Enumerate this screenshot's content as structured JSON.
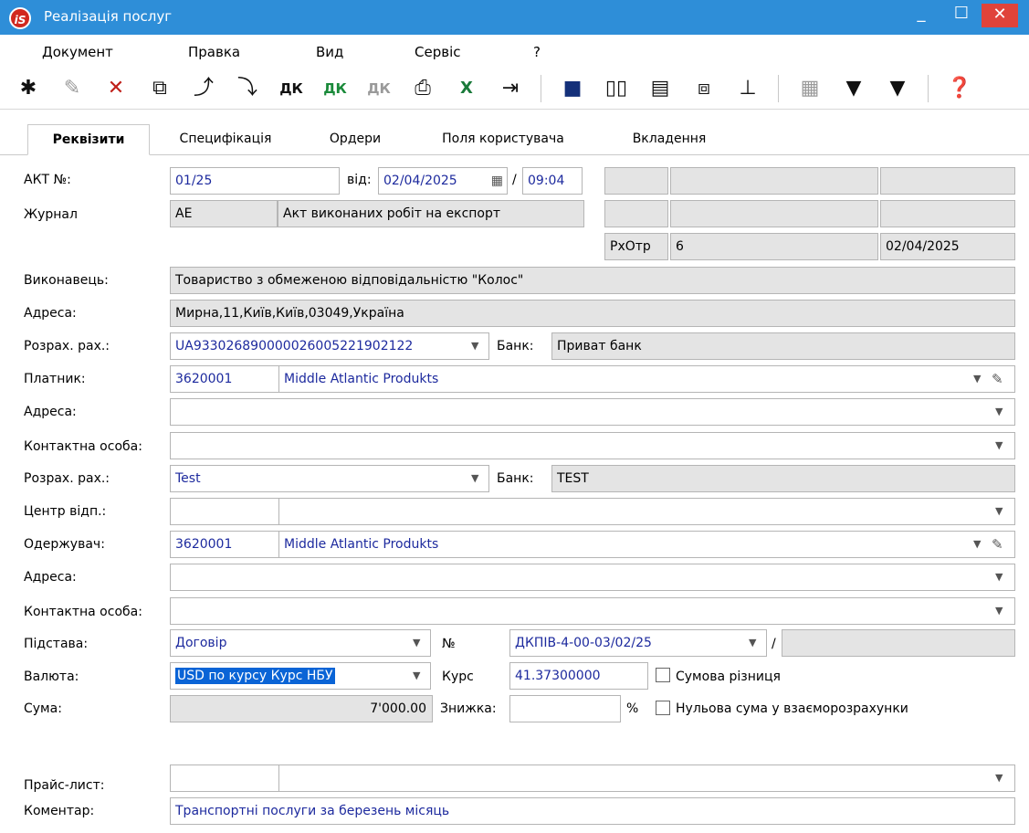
{
  "window": {
    "title": "Реалізація послуг",
    "logo": "iS"
  },
  "menu": [
    "Документ",
    "Правка",
    "Вид",
    "Сервіс",
    "?"
  ],
  "toolbar_icons": [
    "new-doc-icon",
    "edit-doc-icon",
    "delete-doc-icon",
    "copy-doc-icon",
    "import-doc-icon",
    "export-doc-icon",
    "dk-icon",
    "dk-green-icon",
    "dk-disabled-icon",
    "print-icon",
    "excel-icon",
    "exit-icon",
    "save-icon",
    "book-icon",
    "folder-icon",
    "link-icon",
    "tree-icon",
    "grid-icon",
    "filter-icon",
    "clear-filter-icon",
    "help-icon"
  ],
  "tabs": [
    "Реквізити",
    "Специфікація",
    "Ордери",
    "Поля користувача",
    "Вкладення"
  ],
  "form": {
    "akt_label": "АКТ №:",
    "akt_number": "01/25",
    "from_label": "від:",
    "date": "02/04/2025",
    "slash": "/",
    "time": "09:04",
    "journal_label": "Журнал",
    "journal_code": "АЕ",
    "journal_name": "Акт виконаних робіт на експорт",
    "rxotr_label": "РхОтр",
    "rxotr_value": "6",
    "rxotr_date": "02/04/2025",
    "executor_label": "Виконавець:",
    "executor_value": "Товариство з обмеженою відповідальністю \"Колос\"",
    "address_label": "Адреса:",
    "executor_address": "Мирна,11,Київ,Київ,03049,Україна",
    "account_label": "Розрах. рах.:",
    "executor_account": "UA933026890000026005221902122",
    "bank_label": "Банк:",
    "executor_bank": "Приват банк",
    "payer_label": "Платник:",
    "payer_code": "3620001",
    "payer_name": "Middle Atlantic Produkts",
    "payer_address": "",
    "contact_label": "Контактна особа:",
    "payer_contact": "",
    "payer_account": "Test",
    "payer_bank": "TEST",
    "center_label": "Центр відп.:",
    "center_code": "",
    "center_name": "",
    "receiver_label": "Одержувач:",
    "receiver_code": "3620001",
    "receiver_name": "Middle Atlantic Produkts",
    "receiver_address": "",
    "receiver_contact": "",
    "basis_label": "Підстава:",
    "basis_value": "Договір",
    "num_label": "№",
    "contract_number": "ДКПІВ-4-00-03/02/25",
    "currency_label": "Валюта:",
    "currency_value": "USD по курсу Курс НБУ",
    "rate_label": "Курс",
    "rate_value": "41.37300000",
    "sum_diff_label": "Сумова різниця",
    "sum_label": "Сума:",
    "sum_value": "7'000.00",
    "discount_label": "Знижка:",
    "discount_value": "",
    "percent": "%",
    "zero_sum_label": "Нульова сума у взаєморозрахунки",
    "pricelist_label": "Прайс-лист:",
    "pricelist_code": "",
    "pricelist_name": "",
    "comment_label": "Коментар:",
    "comment_value": "Транспортні послуги за березень місяць"
  }
}
